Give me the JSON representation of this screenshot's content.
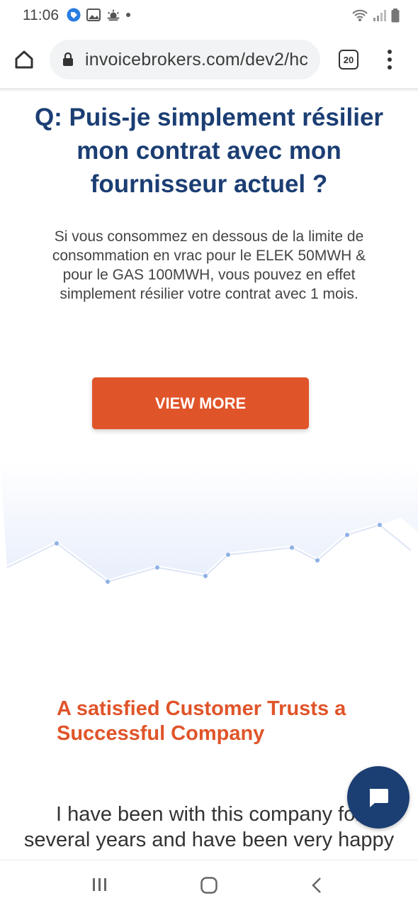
{
  "status_bar": {
    "time": "11:06",
    "icons": [
      "tag-notification-icon",
      "image-notification-icon",
      "weather-icon",
      "dot-icon",
      "wifi-icon",
      "signal-icon",
      "battery-icon"
    ]
  },
  "browser": {
    "url": "invoicebrokers.com/dev2/hc",
    "tab_count": "20"
  },
  "faq": {
    "question": "Q: Puis-je simplement résilier mon contrat avec mon fournisseur actuel ?",
    "answer": "Si vous consommez en dessous de la limite de consommation en vrac pour le ELEK 50MWH & pour le GAS 100MWH, vous pouvez en effet simplement résilier votre contrat avec 1 mois.",
    "button_label": "VIEW MORE"
  },
  "testimonial": {
    "heading": "A satisfied Customer Trusts a Successful Company",
    "text": "I have been with this company for several years and have been very happy"
  },
  "colors": {
    "heading_blue": "#1b3e73",
    "accent_orange": "#e05429",
    "chat_button": "#1b3e73"
  },
  "nav_bar": {
    "buttons": [
      "recent-apps-icon",
      "home-icon",
      "back-icon"
    ]
  }
}
